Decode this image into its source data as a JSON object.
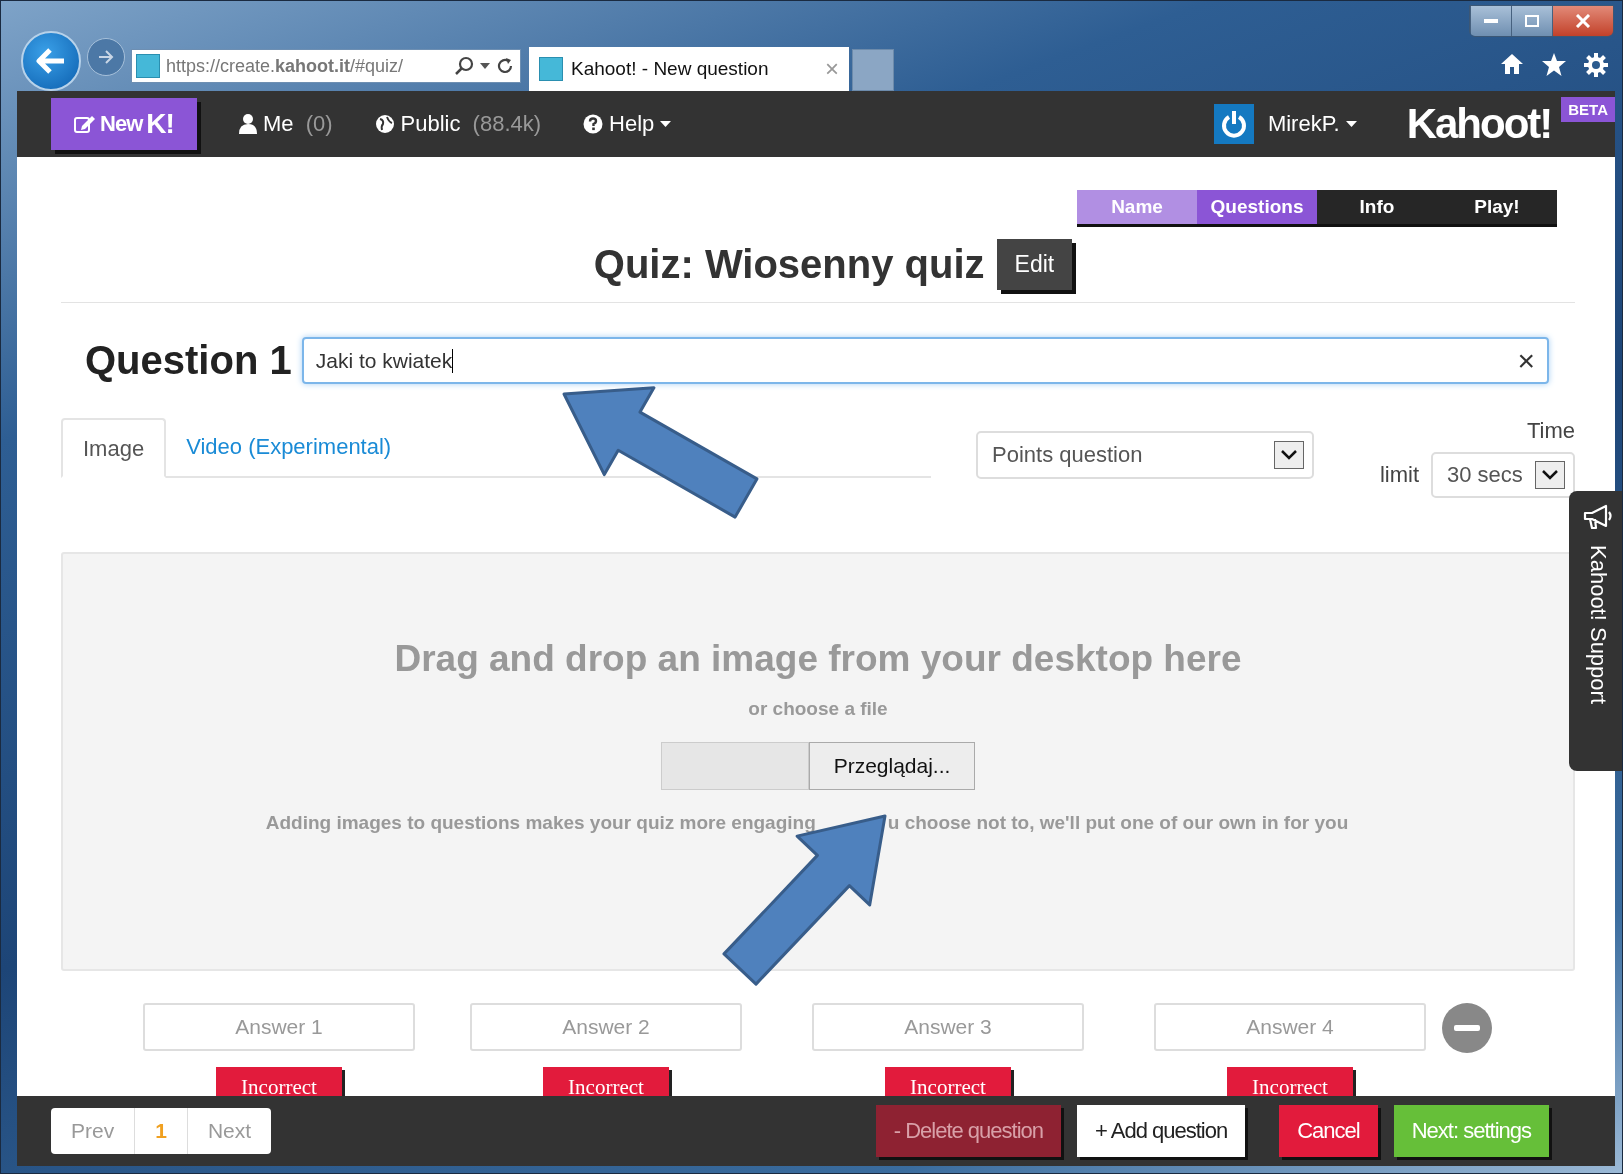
{
  "browser": {
    "address": "https://create.**kahoot.it**/#quiz/",
    "tab_title": "Kahoot! - New question",
    "tab_close": "×"
  },
  "navbar": {
    "new_button": {
      "label": "New",
      "mark": "K!"
    },
    "menu": [
      {
        "kind": "user",
        "label": "Me",
        "count": "(0)"
      },
      {
        "kind": "globe",
        "label": "Public",
        "count": "(88.4k)"
      },
      {
        "kind": "help",
        "label": "Help"
      }
    ],
    "user": "MirekP.",
    "logo": "Kahoot!",
    "badge": "BETA"
  },
  "steps": [
    {
      "label": "Name",
      "completed": true,
      "selected": false
    },
    {
      "label": "Questions",
      "completed": false,
      "selected": true
    },
    {
      "label": "Info",
      "completed": false,
      "selected": false
    },
    {
      "label": "Play!",
      "completed": false,
      "selected": false
    }
  ],
  "quiz_title": "Quiz: Wiosenny quiz",
  "edit_button": "Edit",
  "question": {
    "label": "Question 1",
    "value": "Jaki to kwiatek",
    "clear": "×"
  },
  "media_tabs": [
    {
      "label": "Image",
      "selected": true
    },
    {
      "label": "Video (Experimental)",
      "selected": false
    }
  ],
  "question_type": "Points question",
  "time_limit": {
    "label_top": "Time",
    "label_bottom": "limit",
    "value": "30 secs"
  },
  "dropzone": {
    "heading": "Drag and drop an image from your desktop here",
    "subheading": "or choose a file",
    "browse_button": "Przeglądaj...",
    "note_parts": [
      "Adding images to questions makes your quiz more engaging",
      "u choose not to, we'll put one of our own in for you"
    ]
  },
  "answers": [
    {
      "placeholder": "Answer 1",
      "correct": false,
      "toggle": "Incorrect"
    },
    {
      "placeholder": "Answer 2",
      "correct": false,
      "toggle": "Incorrect"
    },
    {
      "placeholder": "Answer 3",
      "correct": false,
      "toggle": "Incorrect"
    },
    {
      "placeholder": "Answer 4",
      "correct": false,
      "toggle": "Incorrect"
    }
  ],
  "pager": {
    "prev": "Prev",
    "page": "1",
    "next": "Next"
  },
  "footer_buttons": [
    {
      "kind": "delete",
      "label": "- Delete question"
    },
    {
      "kind": "add",
      "label": "+ Add question"
    },
    {
      "kind": "cancel",
      "label": "Cancel"
    },
    {
      "kind": "next",
      "label": "Next: settings"
    }
  ],
  "support_tab": "Kahoot! Support"
}
